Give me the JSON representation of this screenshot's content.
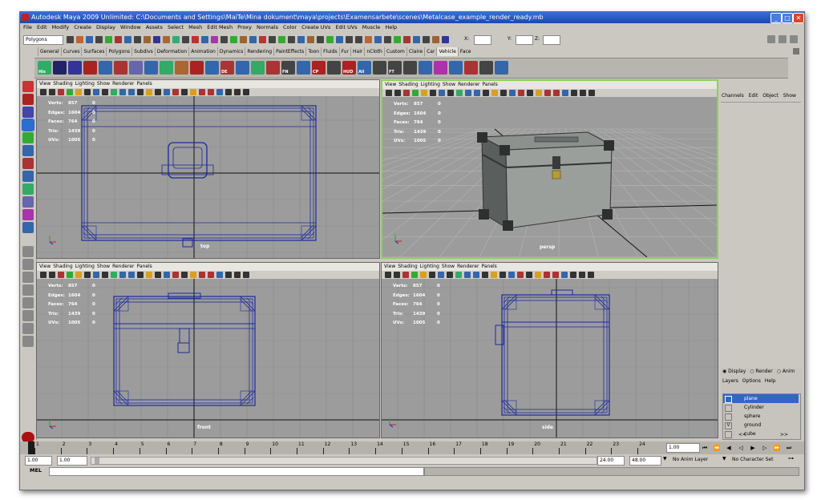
{
  "window": {
    "title": "Autodesk Maya 2009 Unlimited: C:\\Documents and Settings\\MaiTe\\Mina dokument\\maya\\projects\\Examensarbete\\scenes\\Metalcase_example_render_ready.mb",
    "controls": [
      "_",
      "□",
      "✕"
    ]
  },
  "menubar": [
    "File",
    "Edit",
    "Modify",
    "Create",
    "Display",
    "Window",
    "Assets",
    "Select",
    "Mesh",
    "Edit Mesh",
    "Proxy",
    "Normals",
    "Color",
    "Create UVs",
    "Edit UVs",
    "Muscle",
    "Help"
  ],
  "statusline": {
    "mode": "Polygons",
    "x_label": "X:",
    "y_label": "Y:",
    "z_label": "Z:"
  },
  "shelf_tabs": [
    "General",
    "Curves",
    "Surfaces",
    "Polygons",
    "Subdivs",
    "Deformation",
    "Animation",
    "Dynamics",
    "Rendering",
    "PaintEffects",
    "Toon",
    "Fluids",
    "Fur",
    "Hair",
    "nCloth",
    "Custom",
    "Claire",
    "Car",
    "Vehicle",
    "Face"
  ],
  "shelf_icon_labels": [
    "His",
    "DE",
    "FN",
    "CP",
    "HUD",
    "All",
    "FT"
  ],
  "viewport_menu": [
    "View",
    "Shading",
    "Lighting",
    "Show",
    "Renderer",
    "Panels"
  ],
  "hud": {
    "labels": [
      "Verts:",
      "Edges:",
      "Faces:",
      "Tris:",
      "UVs:"
    ],
    "values": [
      "857",
      "1604",
      "764",
      "1439",
      "1005"
    ],
    "zeros": [
      "0",
      "0",
      "0",
      "0",
      "0"
    ]
  },
  "viewports": [
    {
      "camera": "top"
    },
    {
      "camera": "persp"
    },
    {
      "camera": "front"
    },
    {
      "camera": "side"
    }
  ],
  "channelbox": {
    "menu": [
      "Channels",
      "Edit",
      "Object",
      "Show"
    ]
  },
  "layers": {
    "tabs": [
      "Display",
      "Render",
      "Anim"
    ],
    "menu": [
      "Layers",
      "Options",
      "Help"
    ],
    "items": [
      {
        "name": "plane",
        "visible": "",
        "selected": true
      },
      {
        "name": "Cylinder",
        "visible": "",
        "selected": false
      },
      {
        "name": "sphere",
        "visible": "",
        "selected": false
      },
      {
        "name": "ground",
        "visible": "V",
        "selected": false
      },
      {
        "name": "cube",
        "visible": "",
        "selected": false
      }
    ],
    "nav_prev": "<<",
    "nav_next": ">>"
  },
  "timeline": {
    "ticks": [
      "1",
      "2",
      "3",
      "4",
      "5",
      "6",
      "7",
      "8",
      "9",
      "10",
      "11",
      "12",
      "13",
      "14",
      "15",
      "16",
      "17",
      "18",
      "19",
      "20",
      "21",
      "22",
      "23",
      "24"
    ],
    "current_frame": "1.00"
  },
  "range": {
    "start": "1.00",
    "playback_start": "1.00",
    "playback_end": "24.00",
    "end": "48.00",
    "anim_layer": "No Anim Layer",
    "character_set": "No Character Set"
  },
  "mel": {
    "label": "MEL"
  },
  "colors": {
    "wireframe": "#1b2a9c",
    "viewport_bg": "#9c9c9c",
    "active_border": "#8ad15a",
    "titlebar": "#2457c5"
  }
}
